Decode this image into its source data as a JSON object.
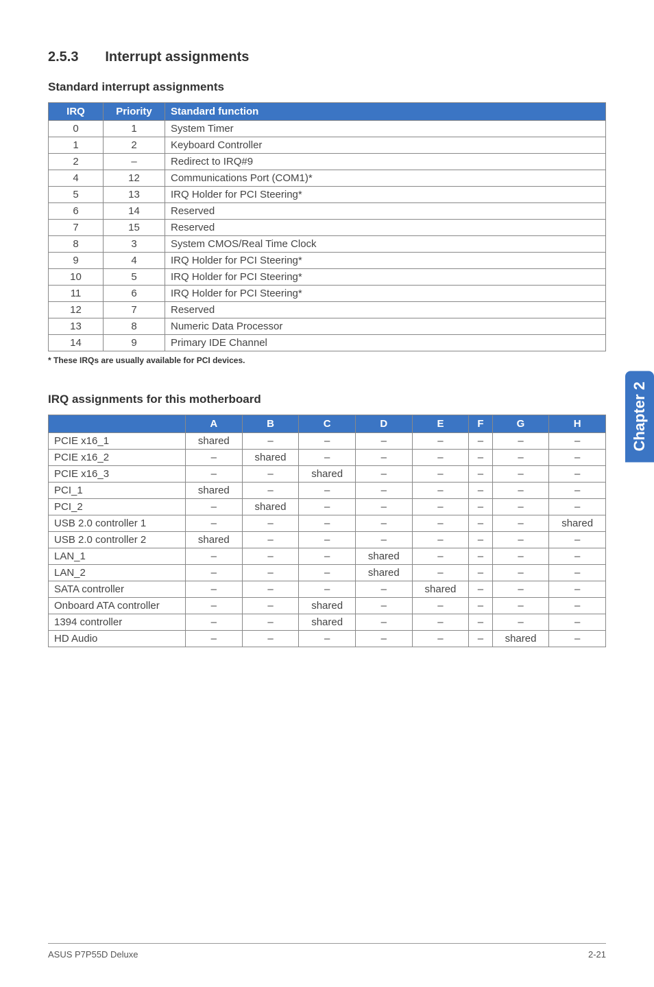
{
  "section": {
    "number": "2.5.3",
    "title": "Interrupt assignments"
  },
  "subheading1": "Standard interrupt assignments",
  "irq_table": {
    "headers": [
      "IRQ",
      "Priority",
      "Standard function"
    ],
    "rows": [
      {
        "irq": "0",
        "priority": "1",
        "func": "System Timer"
      },
      {
        "irq": "1",
        "priority": "2",
        "func": "Keyboard Controller"
      },
      {
        "irq": "2",
        "priority": "–",
        "func": "Redirect to IRQ#9"
      },
      {
        "irq": "4",
        "priority": "12",
        "func": "Communications Port (COM1)*"
      },
      {
        "irq": "5",
        "priority": "13",
        "func": "IRQ Holder for PCI Steering*"
      },
      {
        "irq": "6",
        "priority": "14",
        "func": "Reserved"
      },
      {
        "irq": "7",
        "priority": "15",
        "func": "Reserved"
      },
      {
        "irq": "8",
        "priority": "3",
        "func": "System CMOS/Real Time Clock"
      },
      {
        "irq": "9",
        "priority": "4",
        "func": "IRQ Holder for PCI Steering*"
      },
      {
        "irq": "10",
        "priority": "5",
        "func": "IRQ Holder for PCI Steering*"
      },
      {
        "irq": "11",
        "priority": "6",
        "func": "IRQ Holder for PCI Steering*"
      },
      {
        "irq": "12",
        "priority": "7",
        "func": "Reserved"
      },
      {
        "irq": "13",
        "priority": "8",
        "func": "Numeric Data Processor"
      },
      {
        "irq": "14",
        "priority": "9",
        "func": "Primary IDE Channel"
      }
    ]
  },
  "footnote": "* These IRQs are usually available for PCI devices.",
  "subheading2": "IRQ assignments for this motherboard",
  "assign_table": {
    "headers": [
      "",
      "A",
      "B",
      "C",
      "D",
      "E",
      "F",
      "G",
      "H"
    ],
    "rows": [
      {
        "label": "PCIE x16_1",
        "cells": [
          "shared",
          "–",
          "–",
          "–",
          "–",
          "–",
          "–",
          "–"
        ]
      },
      {
        "label": "PCIE x16_2",
        "cells": [
          "–",
          "shared",
          "–",
          "–",
          "–",
          "–",
          "–",
          "–"
        ]
      },
      {
        "label": "PCIE x16_3",
        "cells": [
          "–",
          "–",
          "shared",
          "–",
          "–",
          "–",
          "–",
          "–"
        ]
      },
      {
        "label": "PCI_1",
        "cells": [
          "shared",
          "–",
          "–",
          "–",
          "–",
          "–",
          "–",
          "–"
        ]
      },
      {
        "label": "PCI_2",
        "cells": [
          "–",
          "shared",
          "–",
          "–",
          "–",
          "–",
          "–",
          "–"
        ]
      },
      {
        "label": "USB 2.0 controller 1",
        "cells": [
          "–",
          "–",
          "–",
          "–",
          "–",
          "–",
          "–",
          "shared"
        ]
      },
      {
        "label": "USB 2.0 controller 2",
        "cells": [
          "shared",
          "–",
          "–",
          "–",
          "–",
          "–",
          "–",
          "–"
        ]
      },
      {
        "label": "LAN_1",
        "cells": [
          "–",
          "–",
          "–",
          "shared",
          "–",
          "–",
          "–",
          "–"
        ]
      },
      {
        "label": "LAN_2",
        "cells": [
          "–",
          "–",
          "–",
          "shared",
          "–",
          "–",
          "–",
          "–"
        ]
      },
      {
        "label": "SATA controller",
        "cells": [
          "–",
          "–",
          "–",
          "–",
          "shared",
          "–",
          "–",
          "–"
        ]
      },
      {
        "label": "Onboard ATA controller",
        "cells": [
          "–",
          "–",
          "shared",
          "–",
          "–",
          "–",
          "–",
          "–"
        ]
      },
      {
        "label": "1394 controller",
        "cells": [
          "–",
          "–",
          "shared",
          "–",
          "–",
          "–",
          "–",
          "–"
        ]
      },
      {
        "label": "HD Audio",
        "cells": [
          "–",
          "–",
          "–",
          "–",
          "–",
          "–",
          "shared",
          "–"
        ]
      }
    ]
  },
  "side_tab": "Chapter 2",
  "footer": {
    "left": "ASUS P7P55D Deluxe",
    "right": "2-21"
  }
}
